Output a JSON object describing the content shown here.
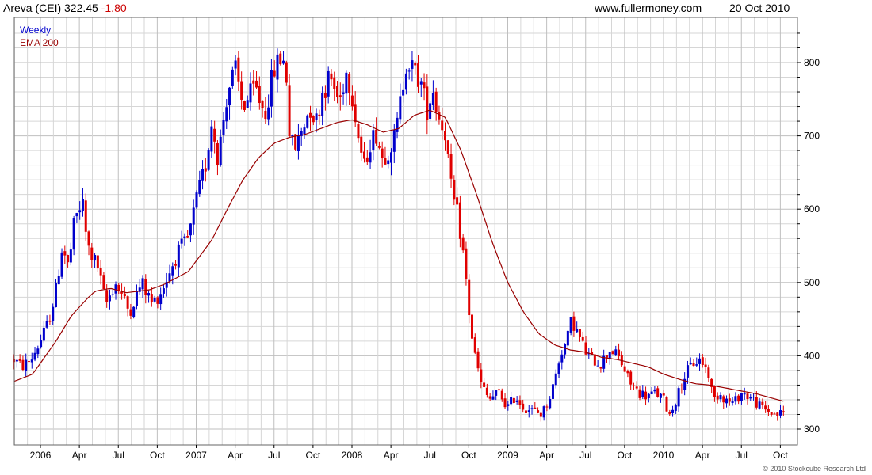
{
  "header": {
    "title": "Areva (CEI) 322.45",
    "change": "-1.80",
    "site": "www.fullermoney.com",
    "date": "20 Oct 2010"
  },
  "copyright": "© 2010 Stockcube Research Ltd",
  "colors": {
    "up": "#0000cc",
    "down": "#e00000",
    "ema": "#990000",
    "grid": "#d6d6d6",
    "gridMajor": "#bfbfbf"
  },
  "chart_data": {
    "type": "candlestick",
    "title": "Areva (CEI) 322.45 -1.80",
    "frequency": "Weekly",
    "ylim": [
      287,
      850
    ],
    "y_ticks": [
      300,
      400,
      500,
      600,
      700,
      800
    ],
    "x_ticks": [
      {
        "label": "2006",
        "t": 0.0
      },
      {
        "label": "Apr",
        "t": 0.25
      },
      {
        "label": "Jul",
        "t": 0.5
      },
      {
        "label": "Oct",
        "t": 0.75
      },
      {
        "label": "2007",
        "t": 1.0
      },
      {
        "label": "Apr",
        "t": 1.25
      },
      {
        "label": "Jul",
        "t": 1.5
      },
      {
        "label": "Oct",
        "t": 1.75
      },
      {
        "label": "2008",
        "t": 2.0
      },
      {
        "label": "Apr",
        "t": 2.25
      },
      {
        "label": "Jul",
        "t": 2.5
      },
      {
        "label": "Oct",
        "t": 2.75
      },
      {
        "label": "2009",
        "t": 3.0
      },
      {
        "label": "Apr",
        "t": 3.25
      },
      {
        "label": "Jul",
        "t": 3.5
      },
      {
        "label": "Oct",
        "t": 3.75
      },
      {
        "label": "2010",
        "t": 4.0
      },
      {
        "label": "Apr",
        "t": 4.25
      },
      {
        "label": "Jul",
        "t": 4.5
      },
      {
        "label": "Oct",
        "t": 4.75
      }
    ],
    "legend": [
      {
        "name": "Weekly",
        "color": "#0000cc"
      },
      {
        "name": "EMA 200",
        "color": "#990000"
      }
    ],
    "price_keypoints": [
      [
        -0.17,
        395
      ],
      [
        -0.12,
        385
      ],
      [
        -0.06,
        395
      ],
      [
        0.0,
        420
      ],
      [
        0.05,
        445
      ],
      [
        0.1,
        490
      ],
      [
        0.14,
        550
      ],
      [
        0.18,
        520
      ],
      [
        0.22,
        585
      ],
      [
        0.27,
        610
      ],
      [
        0.3,
        550
      ],
      [
        0.37,
        520
      ],
      [
        0.42,
        470
      ],
      [
        0.48,
        500
      ],
      [
        0.52,
        485
      ],
      [
        0.57,
        460
      ],
      [
        0.65,
        500
      ],
      [
        0.72,
        470
      ],
      [
        0.78,
        490
      ],
      [
        0.88,
        540
      ],
      [
        0.95,
        560
      ],
      [
        1.0,
        610
      ],
      [
        1.06,
        660
      ],
      [
        1.1,
        720
      ],
      [
        1.14,
        670
      ],
      [
        1.2,
        760
      ],
      [
        1.25,
        790
      ],
      [
        1.3,
        740
      ],
      [
        1.38,
        765
      ],
      [
        1.44,
        730
      ],
      [
        1.5,
        790
      ],
      [
        1.55,
        810
      ],
      [
        1.58,
        780
      ],
      [
        1.6,
        700
      ],
      [
        1.63,
        680
      ],
      [
        1.68,
        710
      ],
      [
        1.73,
        740
      ],
      [
        1.77,
        720
      ],
      [
        1.81,
        760
      ],
      [
        1.86,
        780
      ],
      [
        1.92,
        745
      ],
      [
        1.96,
        790
      ],
      [
        2.0,
        760
      ],
      [
        2.04,
        700
      ],
      [
        2.08,
        655
      ],
      [
        2.11,
        690
      ],
      [
        2.16,
        705
      ],
      [
        2.19,
        670
      ],
      [
        2.23,
        680
      ],
      [
        2.28,
        700
      ],
      [
        2.32,
        760
      ],
      [
        2.35,
        805
      ],
      [
        2.39,
        790
      ],
      [
        2.44,
        775
      ],
      [
        2.48,
        735
      ],
      [
        2.52,
        765
      ],
      [
        2.55,
        730
      ],
      [
        2.6,
        705
      ],
      [
        2.64,
        620
      ],
      [
        2.68,
        590
      ],
      [
        2.72,
        530
      ],
      [
        2.76,
        440
      ],
      [
        2.79,
        400
      ],
      [
        2.83,
        360
      ],
      [
        2.88,
        340
      ],
      [
        2.94,
        350
      ],
      [
        3.0,
        330
      ],
      [
        3.05,
        345
      ],
      [
        3.1,
        330
      ],
      [
        3.16,
        325
      ],
      [
        3.22,
        320
      ],
      [
        3.28,
        350
      ],
      [
        3.31,
        375
      ],
      [
        3.34,
        405
      ],
      [
        3.38,
        420
      ],
      [
        3.41,
        450
      ],
      [
        3.45,
        430
      ],
      [
        3.5,
        405
      ],
      [
        3.54,
        395
      ],
      [
        3.6,
        390
      ],
      [
        3.66,
        410
      ],
      [
        3.72,
        395
      ],
      [
        3.78,
        365
      ],
      [
        3.84,
        350
      ],
      [
        3.9,
        345
      ],
      [
        3.95,
        350
      ],
      [
        4.0,
        340
      ],
      [
        4.04,
        320
      ],
      [
        4.08,
        340
      ],
      [
        4.14,
        375
      ],
      [
        4.19,
        390
      ],
      [
        4.24,
        395
      ],
      [
        4.29,
        375
      ],
      [
        4.32,
        340
      ],
      [
        4.36,
        350
      ],
      [
        4.4,
        340
      ],
      [
        4.45,
        335
      ],
      [
        4.5,
        350
      ],
      [
        4.54,
        345
      ],
      [
        4.58,
        340
      ],
      [
        4.62,
        330
      ],
      [
        4.67,
        325
      ],
      [
        4.72,
        320
      ],
      [
        4.77,
        322
      ]
    ],
    "ema_keypoints": [
      [
        -0.17,
        365
      ],
      [
        -0.05,
        375
      ],
      [
        0.0,
        390
      ],
      [
        0.1,
        420
      ],
      [
        0.2,
        455
      ],
      [
        0.3,
        478
      ],
      [
        0.35,
        488
      ],
      [
        0.45,
        492
      ],
      [
        0.55,
        486
      ],
      [
        0.7,
        490
      ],
      [
        0.8,
        498
      ],
      [
        0.95,
        515
      ],
      [
        1.1,
        558
      ],
      [
        1.2,
        600
      ],
      [
        1.3,
        640
      ],
      [
        1.4,
        670
      ],
      [
        1.5,
        690
      ],
      [
        1.6,
        698
      ],
      [
        1.7,
        702
      ],
      [
        1.8,
        710
      ],
      [
        1.9,
        718
      ],
      [
        2.0,
        722
      ],
      [
        2.1,
        715
      ],
      [
        2.2,
        705
      ],
      [
        2.3,
        710
      ],
      [
        2.4,
        728
      ],
      [
        2.5,
        735
      ],
      [
        2.6,
        725
      ],
      [
        2.7,
        680
      ],
      [
        2.8,
        620
      ],
      [
        2.9,
        555
      ],
      [
        3.0,
        500
      ],
      [
        3.1,
        460
      ],
      [
        3.2,
        430
      ],
      [
        3.3,
        415
      ],
      [
        3.4,
        408
      ],
      [
        3.5,
        405
      ],
      [
        3.6,
        398
      ],
      [
        3.7,
        395
      ],
      [
        3.8,
        390
      ],
      [
        3.9,
        385
      ],
      [
        4.0,
        375
      ],
      [
        4.1,
        368
      ],
      [
        4.2,
        362
      ],
      [
        4.3,
        360
      ],
      [
        4.4,
        356
      ],
      [
        4.5,
        352
      ],
      [
        4.6,
        348
      ],
      [
        4.7,
        342
      ],
      [
        4.77,
        338
      ]
    ],
    "weekly_weeks": 258,
    "t_range": [
      -0.17,
      4.77
    ]
  }
}
